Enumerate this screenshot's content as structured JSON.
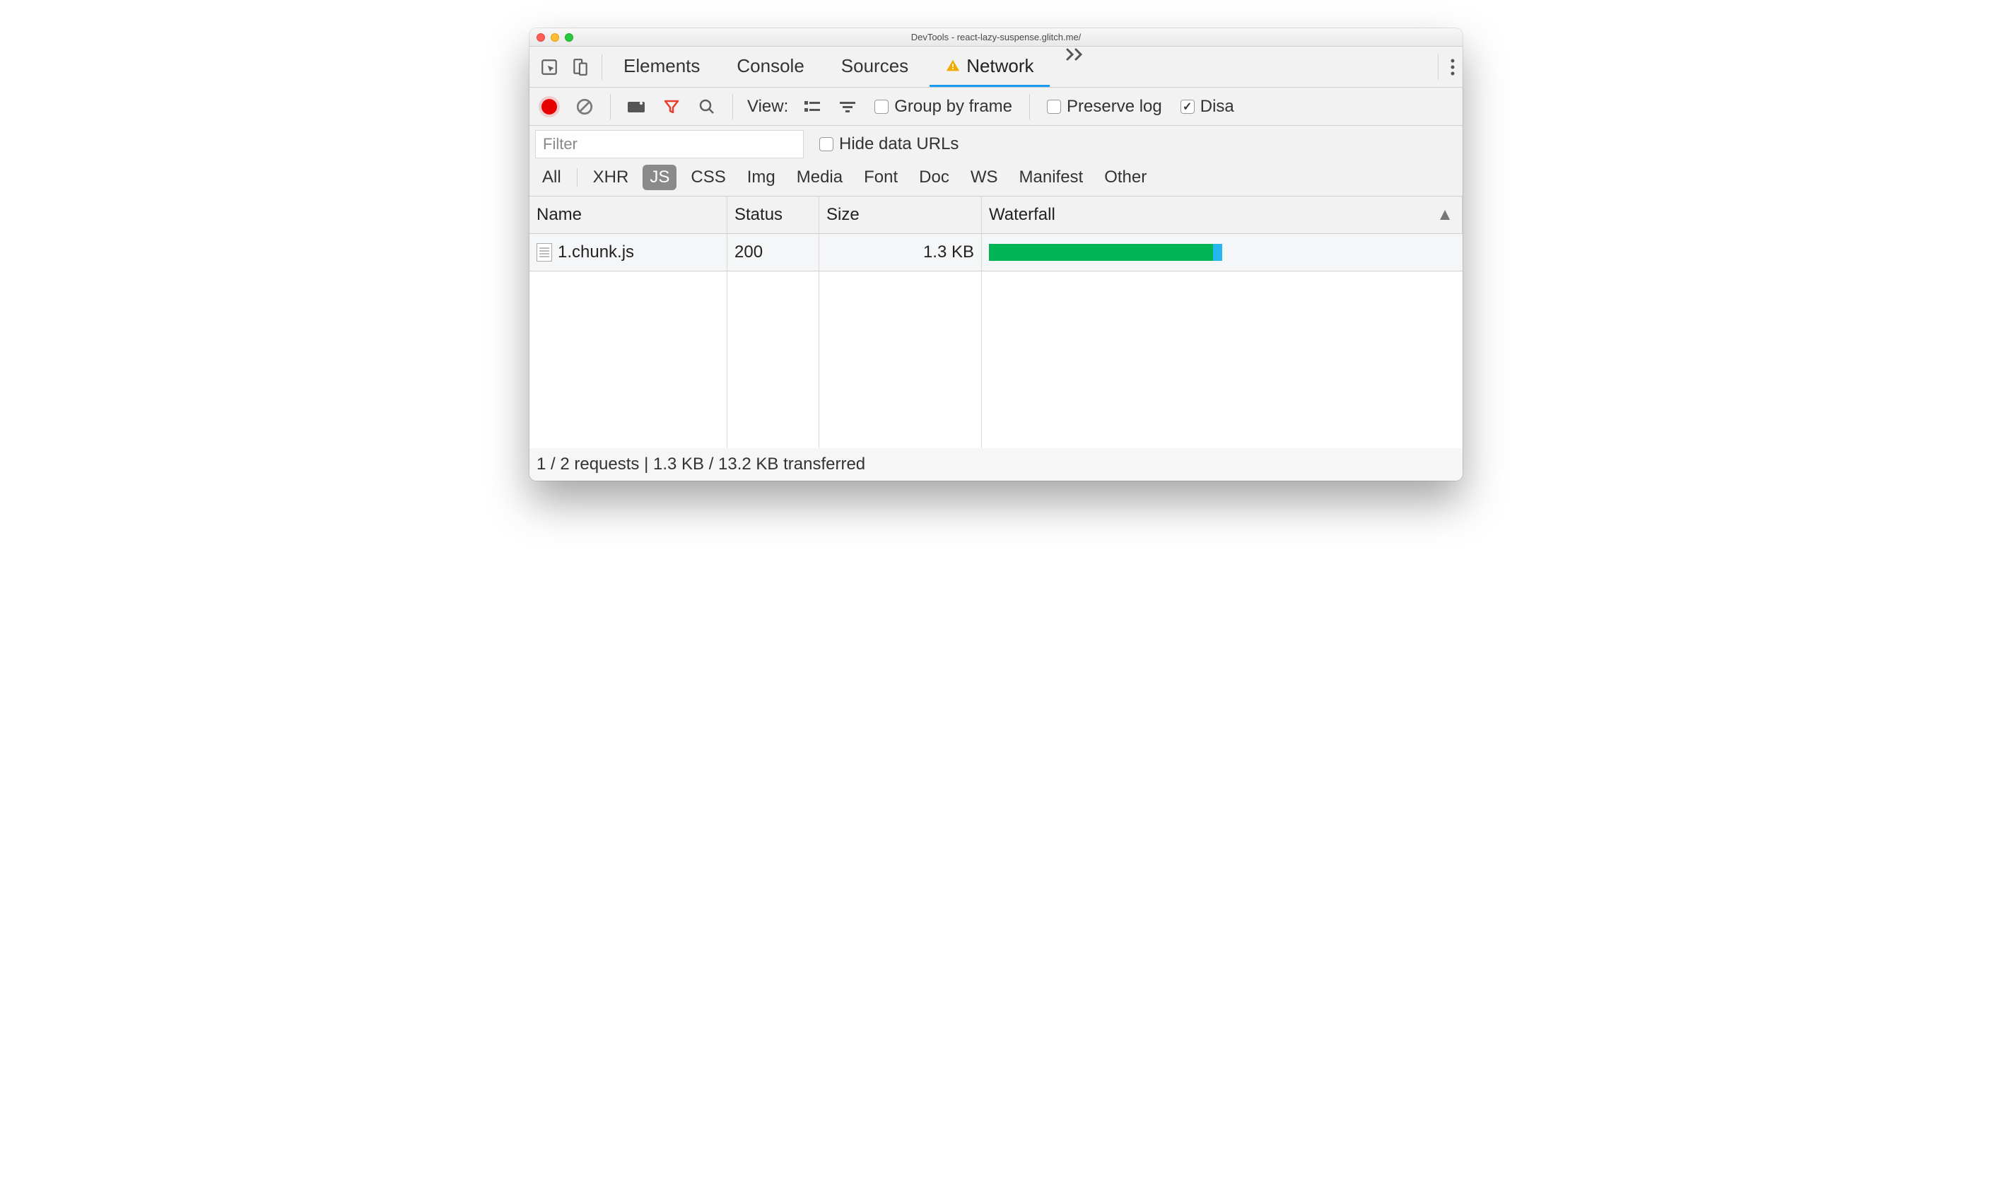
{
  "window": {
    "title": "DevTools - react-lazy-suspense.glitch.me/"
  },
  "tabs": {
    "items": [
      "Elements",
      "Console",
      "Sources",
      "Network"
    ],
    "active_index": 3,
    "active_has_warning": true
  },
  "toolbar": {
    "view_label": "View:",
    "group_by_frame_label": "Group by frame",
    "preserve_log_label": "Preserve log",
    "disable_cache_label": "Disable cache",
    "disable_cache_visible_prefix": "Disa",
    "group_by_frame_checked": false,
    "preserve_log_checked": false,
    "disable_cache_checked": true
  },
  "filter": {
    "placeholder": "Filter",
    "hide_data_urls_label": "Hide data URLs",
    "hide_data_urls_checked": false
  },
  "type_filters": {
    "items": [
      "All",
      "XHR",
      "JS",
      "CSS",
      "Img",
      "Media",
      "Font",
      "Doc",
      "WS",
      "Manifest",
      "Other"
    ],
    "active_index": 2
  },
  "columns": {
    "name": "Name",
    "status": "Status",
    "size": "Size",
    "waterfall": "Waterfall"
  },
  "rows": [
    {
      "name": "1.chunk.js",
      "status": "200",
      "size": "1.3 KB",
      "waterfall": {
        "start_pct": 0,
        "duration_pct": 48,
        "tail_pct": 2
      }
    }
  ],
  "status_bar": {
    "text": "1 / 2 requests | 1.3 KB / 13.2 KB transferred"
  }
}
